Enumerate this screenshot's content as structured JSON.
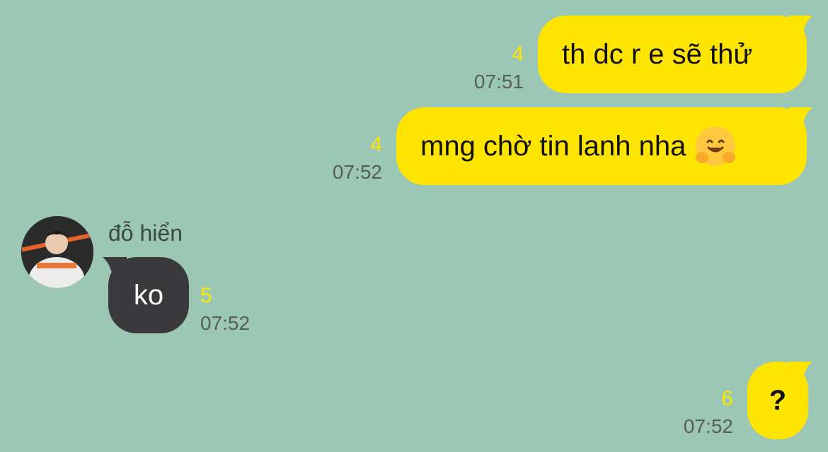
{
  "messages": [
    {
      "id": "m1",
      "direction": "out",
      "text": "th dc r e sẽ thử",
      "unread": "4",
      "time": "07:51"
    },
    {
      "id": "m2",
      "direction": "out",
      "text": "mng chờ tin lanh nha",
      "emoji": "hugging-face",
      "unread": "4",
      "time": "07:52"
    },
    {
      "id": "m3",
      "direction": "in",
      "sender": "đỗ hiển",
      "text": "ko",
      "unread": "5",
      "time": "07:52"
    },
    {
      "id": "m4",
      "direction": "out",
      "text": "?",
      "unread": "6",
      "time": "07:52"
    }
  ],
  "colors": {
    "background": "#9dc7b5",
    "outgoing_bubble": "#fee500",
    "incoming_bubble": "#3a3a3c",
    "unread_count": "#fee500",
    "timestamp": "#555e59"
  }
}
